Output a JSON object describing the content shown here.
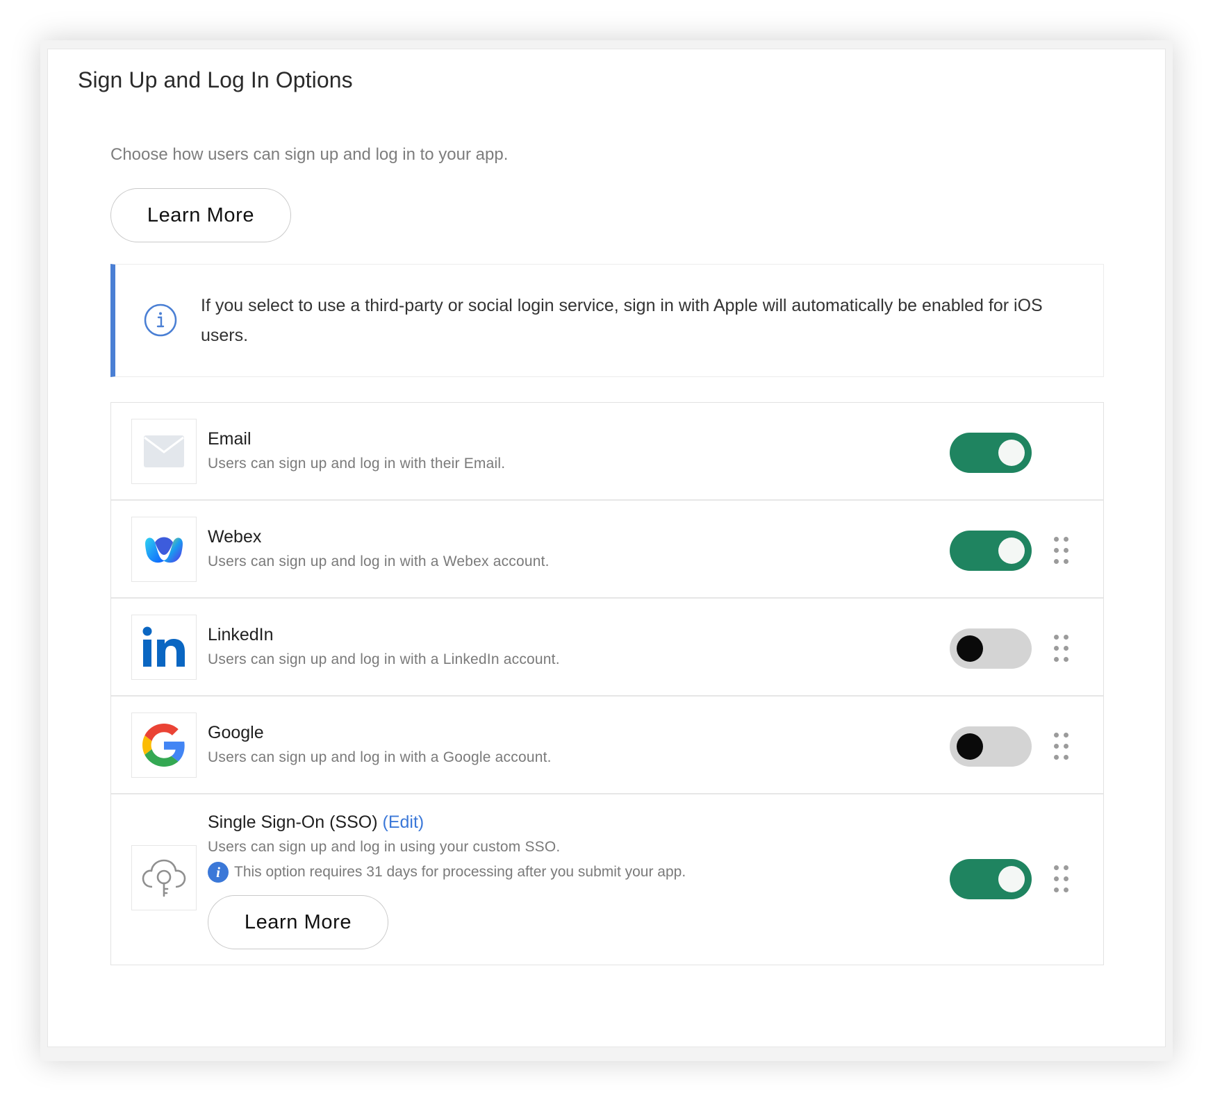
{
  "page": {
    "title": "Sign Up and Log In Options",
    "intro": "Choose how users can sign up and log in to your app.",
    "learn_more_label": "Learn More"
  },
  "info_callout": {
    "icon": "info-circle-icon",
    "text": "If you select to use a third-party or social login service, sign in with Apple will automatically be enabled for iOS users."
  },
  "options": [
    {
      "id": "email",
      "title": "Email",
      "description": "Users can sign up and log in with their Email.",
      "enabled": true,
      "icon": "envelope-icon",
      "draggable": false
    },
    {
      "id": "webex",
      "title": "Webex",
      "description": "Users can sign up and log in with a Webex account.",
      "enabled": true,
      "icon": "webex-logo-icon",
      "draggable": true
    },
    {
      "id": "linkedin",
      "title": "LinkedIn",
      "description": "Users can sign up and log in with a LinkedIn account.",
      "enabled": false,
      "icon": "linkedin-logo-icon",
      "draggable": true
    },
    {
      "id": "google",
      "title": "Google",
      "description": "Users can sign up and log in with a Google account.",
      "enabled": false,
      "icon": "google-logo-icon",
      "draggable": true
    }
  ],
  "sso": {
    "title": "Single Sign-On (SSO)",
    "edit_label": "(Edit)",
    "description": "Users can sign up and log in using your custom SSO.",
    "note_icon_glyph": "i",
    "note": "This option requires 31 days for processing after you submit your app.",
    "learn_more_label": "Learn More",
    "enabled": true,
    "icon": "cloud-key-icon"
  },
  "colors": {
    "toggle_on": "#1f8460",
    "toggle_off": "#d4d4d4",
    "accent_blue": "#3b78d8",
    "linkedin_blue": "#0a66c2"
  }
}
